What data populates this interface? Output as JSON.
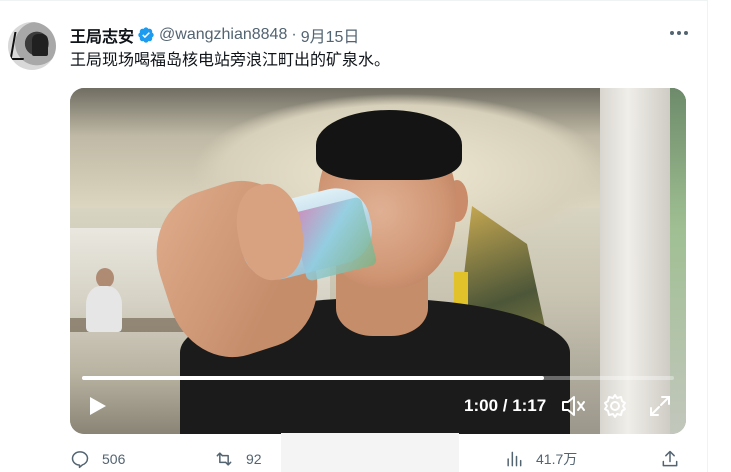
{
  "author": {
    "name": "王局志安",
    "handle": "@wangzhian8848",
    "date": "9月15日",
    "verified": true,
    "verified_color": "#1d9bf0"
  },
  "tweet": {
    "text": "王局现场喝福岛核电站旁浪江町出的矿泉水。"
  },
  "video": {
    "time": "1:00 / 1:17",
    "progress": 0.78,
    "icons": [
      "play-icon",
      "volume-icon",
      "settings-icon",
      "fullscreen-icon"
    ]
  },
  "actions": {
    "replies": "506",
    "retweets": "92",
    "views": "41.7万"
  },
  "colors": {
    "text_primary": "#0f1419",
    "text_secondary": "#536471",
    "accent": "#1d9bf0"
  }
}
